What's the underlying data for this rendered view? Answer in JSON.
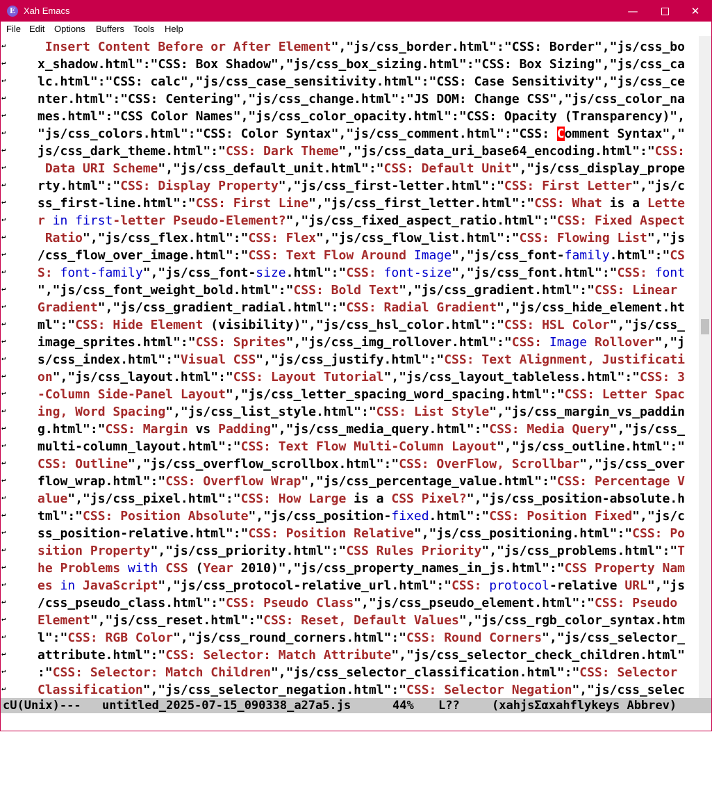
{
  "window": {
    "title": "Xah Emacs",
    "icon_name": "emacs-icon",
    "icon_glyph": "E",
    "controls": {
      "minimize": "—",
      "close": "✕"
    }
  },
  "menubar": {
    "items": [
      "File",
      "Edit",
      "Options",
      "Buffers",
      "Tools",
      "Help"
    ]
  },
  "editor": {
    "wrap_glyph": "↵",
    "lines": [
      [
        [
          "k",
          " Insert Content Before or After Element"
        ],
        [
          "s",
          "\",\"js/css_border.html\":\"CSS: Border\",\"js/css_bo"
        ]
      ],
      [
        [
          "s",
          "x_shadow.html\":\"CSS: Box Shadow\",\"js/css_box_sizing.html\":\"CSS: Box Sizing\",\"js/css_ca"
        ]
      ],
      [
        [
          "s",
          "lc.html\":\"CSS: calc\",\"js/css_case_sensitivity.html\":\"CSS: Case Sensitivity\",\"js/css_ce"
        ]
      ],
      [
        [
          "s",
          "nter.html\":\"CSS: Centering\",\"js/css_change.html\":\"JS DOM: Change CSS\",\"js/css_color_na"
        ]
      ],
      [
        [
          "s",
          "mes.html\":\"CSS Color Names\",\"js/css_color_opacity.html\":\"CSS: Opacity (Transparency)\","
        ]
      ],
      [
        [
          "s",
          "\"js/css_colors.html\":\"CSS: Color Syntax\",\"js/css_comment.html\":\"CSS: "
        ],
        [
          "c",
          "C"
        ],
        [
          "s",
          "omment Syntax\",\""
        ]
      ],
      [
        [
          "s",
          "js/css_dark_theme.html\":\""
        ],
        [
          "k",
          "CSS: Dark Theme"
        ],
        [
          "s",
          "\",\"js/css_data_uri_base64_encoding.html\":\""
        ],
        [
          "k",
          "CSS:"
        ]
      ],
      [
        [
          "k",
          " Data URI Scheme"
        ],
        [
          "s",
          "\",\"js/css_default_unit.html\":\""
        ],
        [
          "k",
          "CSS: Default Unit"
        ],
        [
          "s",
          "\",\"js/css_display_prope"
        ]
      ],
      [
        [
          "s",
          "rty.html\":\""
        ],
        [
          "k",
          "CSS: Display Property"
        ],
        [
          "s",
          "\",\"js/css_first-letter.html\":\""
        ],
        [
          "k",
          "CSS: First Letter"
        ],
        [
          "s",
          "\",\"js/c"
        ]
      ],
      [
        [
          "s",
          "ss_first-line.html\":\""
        ],
        [
          "k",
          "CSS: First Line"
        ],
        [
          "s",
          "\",\"js/css_first_letter.html\":\""
        ],
        [
          "k",
          "CSS: What "
        ],
        [
          "s",
          "is a "
        ],
        [
          "k",
          "Lette"
        ]
      ],
      [
        [
          "k",
          "r "
        ],
        [
          "f",
          "in first"
        ],
        [
          "k",
          "-letter Pseudo-Element?"
        ],
        [
          "s",
          "\",\"js/css_fixed_aspect_ratio.html\":\""
        ],
        [
          "k",
          "CSS: Fixed Aspect"
        ]
      ],
      [
        [
          "k",
          " Ratio"
        ],
        [
          "s",
          "\",\"js/css_flex.html\":\""
        ],
        [
          "k",
          "CSS: Flex"
        ],
        [
          "s",
          "\",\"js/css_flow_list.html\":\""
        ],
        [
          "k",
          "CSS: Flowing List"
        ],
        [
          "s",
          "\",\"js"
        ]
      ],
      [
        [
          "s",
          "/css_flow_over_image.html\":\""
        ],
        [
          "k",
          "CSS: Text Flow Around "
        ],
        [
          "f",
          "Image"
        ],
        [
          "s",
          "\",\"js/css_font-"
        ],
        [
          "f",
          "family"
        ],
        [
          "s",
          ".html\":\""
        ],
        [
          "k",
          "CS"
        ]
      ],
      [
        [
          "k",
          "S: "
        ],
        [
          "f",
          "font-family"
        ],
        [
          "s",
          "\",\"js/css_font-"
        ],
        [
          "f",
          "size"
        ],
        [
          "s",
          ".html\":\""
        ],
        [
          "k",
          "CSS: "
        ],
        [
          "f",
          "font-size"
        ],
        [
          "s",
          "\",\"js/css_font.html\":\""
        ],
        [
          "k",
          "CSS: "
        ],
        [
          "f",
          "font"
        ]
      ],
      [
        [
          "s",
          "\",\"js/css_font_weight_bold.html\":\""
        ],
        [
          "k",
          "CSS: Bold Text"
        ],
        [
          "s",
          "\",\"js/css_gradient.html\":\""
        ],
        [
          "k",
          "CSS: Linear "
        ]
      ],
      [
        [
          "k",
          "Gradient"
        ],
        [
          "s",
          "\",\"js/css_gradient_radial.html\":\""
        ],
        [
          "k",
          "CSS: Radial Gradient"
        ],
        [
          "s",
          "\",\"js/css_hide_element.ht"
        ]
      ],
      [
        [
          "s",
          "ml\":\""
        ],
        [
          "k",
          "CSS: Hide Element "
        ],
        [
          "s",
          "(visibility)\",\"js/css_hsl_color.html\":\""
        ],
        [
          "k",
          "CSS: HSL Color"
        ],
        [
          "s",
          "\",\"js/css_"
        ]
      ],
      [
        [
          "s",
          "image_sprites.html\":\""
        ],
        [
          "k",
          "CSS: Sprites"
        ],
        [
          "s",
          "\",\"js/css_img_rollover.html\":\""
        ],
        [
          "k",
          "CSS: "
        ],
        [
          "f",
          "Image"
        ],
        [
          "k",
          " Rollover"
        ],
        [
          "s",
          "\",\"j"
        ]
      ],
      [
        [
          "s",
          "s/css_index.html\":\""
        ],
        [
          "k",
          "Visual CSS"
        ],
        [
          "s",
          "\",\"js/css_justify.html\":\""
        ],
        [
          "k",
          "CSS: Text Alignment, Justificati"
        ]
      ],
      [
        [
          "k",
          "on"
        ],
        [
          "s",
          "\",\"js/css_layout.html\":\""
        ],
        [
          "k",
          "CSS: Layout Tutorial"
        ],
        [
          "s",
          "\",\"js/css_layout_tableless.html\":\""
        ],
        [
          "k",
          "CSS: 3"
        ]
      ],
      [
        [
          "k",
          "-Column Side-Panel Layout"
        ],
        [
          "s",
          "\",\"js/css_letter_spacing_word_spacing.html\":\""
        ],
        [
          "k",
          "CSS: Letter Spac"
        ]
      ],
      [
        [
          "k",
          "ing, Word Spacing"
        ],
        [
          "s",
          "\",\"js/css_list_style.html\":\""
        ],
        [
          "k",
          "CSS: List Style"
        ],
        [
          "s",
          "\",\"js/css_margin_vs_paddin"
        ]
      ],
      [
        [
          "s",
          "g.html\":\""
        ],
        [
          "k",
          "CSS: Margin "
        ],
        [
          "s",
          "vs "
        ],
        [
          "k",
          "Padding"
        ],
        [
          "s",
          "\",\"js/css_media_query.html\":\""
        ],
        [
          "k",
          "CSS: Media Query"
        ],
        [
          "s",
          "\",\"js/css_"
        ]
      ],
      [
        [
          "s",
          "multi-column_layout.html\":\""
        ],
        [
          "k",
          "CSS: Text Flow Multi-Column Layout"
        ],
        [
          "s",
          "\",\"js/css_outline.html\":\""
        ]
      ],
      [
        [
          "k",
          "CSS: Outline"
        ],
        [
          "s",
          "\",\"js/css_overflow_scrollbox.html\":\""
        ],
        [
          "k",
          "CSS: OverFlow, Scrollbar"
        ],
        [
          "s",
          "\",\"js/css_over"
        ]
      ],
      [
        [
          "s",
          "flow_wrap.html\":\""
        ],
        [
          "k",
          "CSS: Overflow Wrap"
        ],
        [
          "s",
          "\",\"js/css_percentage_value.html\":\""
        ],
        [
          "k",
          "CSS: Percentage V"
        ]
      ],
      [
        [
          "k",
          "alue"
        ],
        [
          "s",
          "\",\"js/css_pixel.html\":\""
        ],
        [
          "k",
          "CSS: How Large "
        ],
        [
          "s",
          "is a "
        ],
        [
          "k",
          "CSS Pixel?"
        ],
        [
          "s",
          "\",\"js/css_position-absolute.h"
        ]
      ],
      [
        [
          "s",
          "tml\":\""
        ],
        [
          "k",
          "CSS: Position Absolute"
        ],
        [
          "s",
          "\",\"js/css_position-"
        ],
        [
          "f",
          "fixed"
        ],
        [
          "s",
          ".html\":\""
        ],
        [
          "k",
          "CSS: Position Fixed"
        ],
        [
          "s",
          "\",\"js/c"
        ]
      ],
      [
        [
          "s",
          "ss_position-relative.html\":\""
        ],
        [
          "k",
          "CSS: Position Relative"
        ],
        [
          "s",
          "\",\"js/css_positioning.html\":\""
        ],
        [
          "k",
          "CSS: Po"
        ]
      ],
      [
        [
          "k",
          "sition Property"
        ],
        [
          "s",
          "\",\"js/css_priority.html\":\""
        ],
        [
          "k",
          "CSS Rules Priority"
        ],
        [
          "s",
          "\",\"js/css_problems.html\":\""
        ],
        [
          "k",
          "T"
        ]
      ],
      [
        [
          "k",
          "he Problems "
        ],
        [
          "f",
          "with"
        ],
        [
          "k",
          " CSS "
        ],
        [
          "s",
          "("
        ],
        [
          "k",
          "Year "
        ],
        [
          "s",
          "2010)\",\"js/css_property_names_in_js.html\":\""
        ],
        [
          "k",
          "CSS Property Nam"
        ]
      ],
      [
        [
          "k",
          "es "
        ],
        [
          "f",
          "in"
        ],
        [
          "k",
          " JavaScript"
        ],
        [
          "s",
          "\",\"js/css_protocol-relative_url.html\":\""
        ],
        [
          "k",
          "CSS: "
        ],
        [
          "f",
          "protocol"
        ],
        [
          "s",
          "-relative "
        ],
        [
          "k",
          "URL"
        ],
        [
          "s",
          "\",\"js"
        ]
      ],
      [
        [
          "s",
          "/css_pseudo_class.html\":\""
        ],
        [
          "k",
          "CSS: Pseudo Class"
        ],
        [
          "s",
          "\",\"js/css_pseudo_element.html\":\""
        ],
        [
          "k",
          "CSS: Pseudo "
        ]
      ],
      [
        [
          "k",
          "Element"
        ],
        [
          "s",
          "\",\"js/css_reset.html\":\""
        ],
        [
          "k",
          "CSS: Reset, Default Values"
        ],
        [
          "s",
          "\",\"js/css_rgb_color_syntax.htm"
        ]
      ],
      [
        [
          "s",
          "l\":\""
        ],
        [
          "k",
          "CSS: RGB Color"
        ],
        [
          "s",
          "\",\"js/css_round_corners.html\":\""
        ],
        [
          "k",
          "CSS: Round Corners"
        ],
        [
          "s",
          "\",\"js/css_selector_"
        ]
      ],
      [
        [
          "s",
          "attribute.html\":\""
        ],
        [
          "k",
          "CSS: Selector: Match Attribute"
        ],
        [
          "s",
          "\",\"js/css_selector_check_children.html\""
        ]
      ],
      [
        [
          "s",
          ":\""
        ],
        [
          "k",
          "CSS: Selector: Match Children"
        ],
        [
          "s",
          "\",\"js/css_selector_classification.html\":\""
        ],
        [
          "k",
          "CSS: Selector "
        ]
      ],
      [
        [
          "k",
          "Classification"
        ],
        [
          "s",
          "\",\"js/css_selector_negation.html\":\""
        ],
        [
          "k",
          "CSS: Selector Negation"
        ],
        [
          "s",
          "\",\"js/css_selec"
        ]
      ]
    ]
  },
  "modeline": {
    "encoding": "cU(Unix)---",
    "buffer_name": "untitled_2025-07-15_090338_a27a5.js",
    "position_percent": "44%",
    "line": "L??",
    "modes": "(xahjsΣαxahflykeys Abbrev)"
  },
  "colors": {
    "titlebar": "#c8004a",
    "keyword": "#a52a2a",
    "function": "#0000cd",
    "cursor": "#ff0000",
    "modeline_bg": "#c8c8c8"
  }
}
